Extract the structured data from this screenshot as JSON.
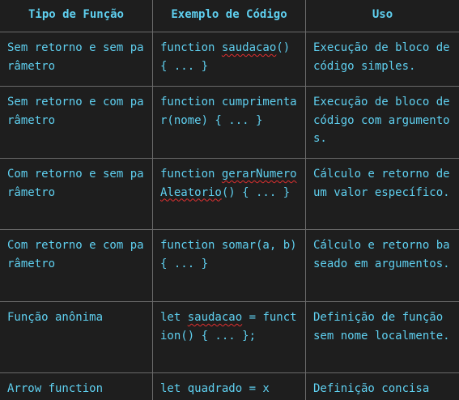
{
  "headers": [
    "Tipo de Função",
    "Exemplo de Código",
    "Uso"
  ],
  "rows": [
    {
      "type": "Sem retorno e sem parâmetro",
      "code_pre": "function ",
      "code_squiggle": "saudacao",
      "code_post": "() { ... }",
      "use": "Execução de bloco de código simples."
    },
    {
      "type": "Sem retorno e com parâmetro",
      "code_pre": "function cumprimentar(nome) { ... }",
      "code_squiggle": "",
      "code_post": "",
      "use": "Execução de bloco de código com argumentos."
    },
    {
      "type": "Com retorno e sem parâmetro",
      "code_pre": "function ",
      "code_squiggle": "gerarNumeroAleatorio",
      "code_post": "() { ... }",
      "use": "Cálculo e retorno de um valor específico."
    },
    {
      "type": "Com retorno e com parâmetro",
      "code_pre": "function somar(a, b) { ... }",
      "code_squiggle": "",
      "code_post": "",
      "use": "Cálculo e retorno baseado em argumentos."
    },
    {
      "type": "Função anônima",
      "code_pre": "let ",
      "code_squiggle": "saudacao",
      "code_post": " = function() { ... };",
      "use": "Definição de função sem nome localmente."
    },
    {
      "type": "Arrow function",
      "code_pre": "let quadrado = x",
      "code_squiggle": "",
      "code_post": "",
      "use": "Definição concisa"
    }
  ],
  "colors": {
    "background": "#1e1e1e",
    "text": "#5fd0f0",
    "border": "#6a6a6a",
    "spellcheck_underline": "#e03030"
  }
}
